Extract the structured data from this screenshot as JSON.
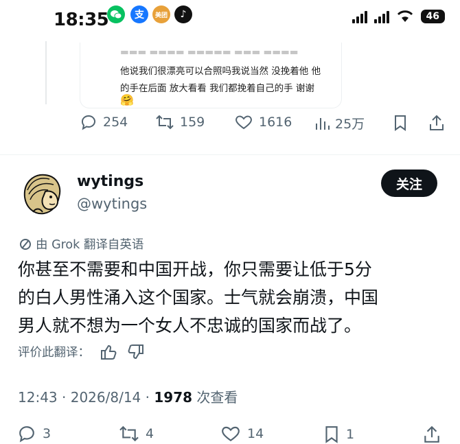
{
  "status_bar": {
    "time": "18:35",
    "app_icons": [
      {
        "name": "wechat-icon",
        "color": "#07c160",
        "glyph": "●"
      },
      {
        "name": "alipay-icon",
        "color": "#1677ff",
        "glyph": "支"
      },
      {
        "name": "meituan-icon",
        "color": "#e8a13a",
        "glyph": "美团"
      },
      {
        "name": "tiktok-icon",
        "color": "#111111",
        "glyph": "♪"
      }
    ],
    "battery": "46"
  },
  "quoted_image": {
    "lines": [
      "他说我们很漂亮可以合照吗我说当然 没挽着他 他",
      "的手在后面 放大看看 我们都挽着自己的手 谢谢"
    ]
  },
  "prev_actions": {
    "replies": "254",
    "reposts": "159",
    "likes": "1616",
    "views": "25万"
  },
  "tweet": {
    "display_name": "wytings",
    "handle": "@wytings",
    "follow_label": "关注",
    "translation_note": "由 Grok 翻译自英语",
    "body_lines": [
      "你甚至不需要和中国开战，你只需要让低于5分",
      "的白人男性涌入这个国家。士气就会崩溃，中国",
      "男人就不想为一个女人不忠诚的国家而战了。"
    ],
    "rate_label": "评价此翻译：",
    "time": "12:43",
    "date": "2026/8/14",
    "views": "1978",
    "views_label": "次查看",
    "actions": {
      "replies": "3",
      "reposts": "4",
      "likes": "14",
      "bookmarks": "1"
    }
  }
}
